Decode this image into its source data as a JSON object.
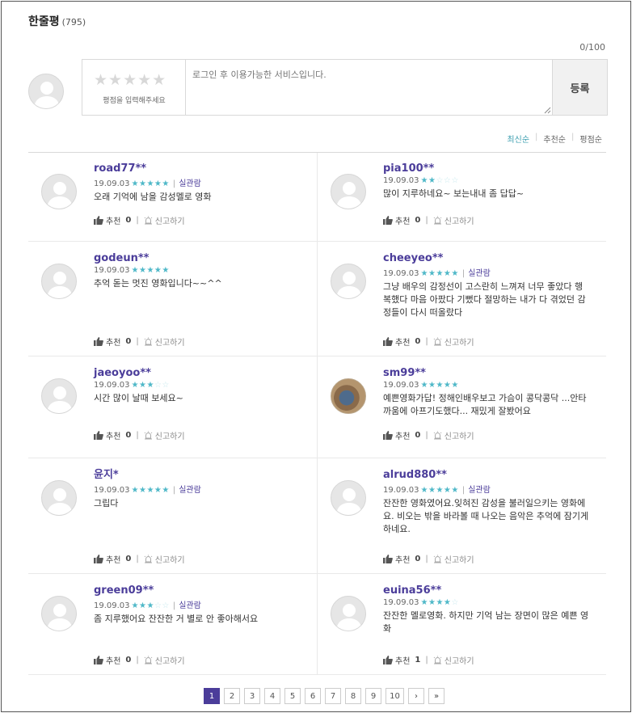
{
  "header": {
    "title": "한줄평",
    "count": "(795)"
  },
  "editor": {
    "counter": "0/100",
    "stars": "★★★★★",
    "rating_hint": "평점을 입력해주세요",
    "placeholder": "로그인 후 이용가능한 서비스입니다.",
    "submit_label": "등록"
  },
  "sort": {
    "latest": "최신순",
    "recommended": "추천순",
    "rating": "평점순",
    "active": "latest"
  },
  "labels": {
    "recommend": "추천",
    "report": "신고하기",
    "verified": "실관람"
  },
  "colors": {
    "accent": "#4b3d9a",
    "stars": "#4fb8c8"
  },
  "reviews": [
    {
      "name": "road77**",
      "date": "19.09.03",
      "rating": 5,
      "verified": true,
      "text": "오래 기억에 남을 감성멜로 영화",
      "recommend": "0"
    },
    {
      "name": "pia100**",
      "date": "19.09.03",
      "rating": 2,
      "verified": false,
      "text": "많이 지루하네요~ 보는내내 좀 답답~",
      "recommend": "0"
    },
    {
      "name": "godeun**",
      "date": "19.09.03",
      "rating": 5,
      "verified": false,
      "text": "추억 돋는 멋진 영화입니다~~^^",
      "recommend": "0"
    },
    {
      "name": "cheeyeo**",
      "date": "19.09.03",
      "rating": 5,
      "verified": true,
      "text": "그냥 배우의 감정선이 고스란히 느껴져 너무 좋았다 행복했다 마음 아팠다 기뻤다 절망하는 내가 다 겪었던 감정들이 다시 떠올랐다",
      "recommend": "0"
    },
    {
      "name": "jaeoyoo**",
      "date": "19.09.03",
      "rating": 3,
      "verified": false,
      "text": "시간 많이 날때 보세요~",
      "recommend": "0"
    },
    {
      "name": "sm99**",
      "date": "19.09.03",
      "rating": 5,
      "verified": false,
      "text": "예쁜영화가답! 정해인배우보고 가슴이 콩닥콩닥 ...안타까움에 아프기도했다... 재밌게 잘봤어요",
      "recommend": "0",
      "photo": true
    },
    {
      "name": "윤지*",
      "date": "19.09.03",
      "rating": 5,
      "verified": true,
      "text": "그립다",
      "recommend": "0"
    },
    {
      "name": "alrud880**",
      "date": "19.09.03",
      "rating": 5,
      "verified": true,
      "text": "잔잔한 영화였어요.잊혀진 감성을 불러일으키는 영화에요. 비오는 밖을 바라볼 때 나오는 음악은 추억에 잠기게 하네요.",
      "recommend": "0"
    },
    {
      "name": "green09**",
      "date": "19.09.03",
      "rating": 3,
      "verified": true,
      "text": "좀 지루했어요 잔잔한 거 별로 안 좋아해서요",
      "recommend": "0"
    },
    {
      "name": "euina56**",
      "date": "19.09.03",
      "rating": 4,
      "verified": false,
      "text": "잔잔한 멜로영화. 하지만 기억 남는 장면이 많은 예쁜 영화",
      "recommend": "1"
    }
  ],
  "pagination": {
    "pages": [
      "1",
      "2",
      "3",
      "4",
      "5",
      "6",
      "7",
      "8",
      "9",
      "10"
    ],
    "current": "1",
    "next": "›",
    "last": "»"
  }
}
